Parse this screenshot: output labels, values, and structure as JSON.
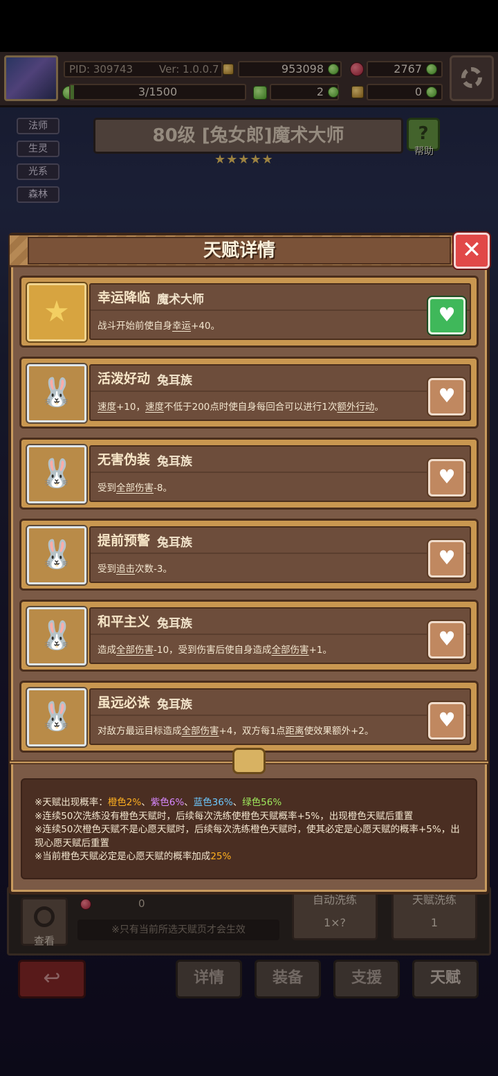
{
  "header": {
    "pid": "PID: 309743",
    "version": "Ver: 1.0.0.7",
    "gold": "953098",
    "gems": "2767",
    "progress": "3/1500",
    "progress_value": 0.002,
    "clover": "2",
    "key": "0"
  },
  "tags": [
    "法师",
    "生灵",
    "光系",
    "森林"
  ],
  "character": {
    "title": "80级  [兔女郎]魔术大师",
    "stars": "★★★★★",
    "help": "帮助"
  },
  "modal": {
    "title": "天赋详情",
    "close": "✕",
    "talents": [
      {
        "name": "幸运降临",
        "cls": "魔术大师",
        "desc_parts": [
          "战斗开始前使自身",
          "幸运",
          "+40。"
        ],
        "selected": true,
        "icon": "star-icon"
      },
      {
        "name": "活泼好动",
        "cls": "兔耳族",
        "desc_parts": [
          "速度",
          "+10，",
          "速度",
          "不低于200点时使自身每回合可以进行1次",
          "额外行动",
          "。"
        ],
        "selected": false,
        "icon": "bunny-icon"
      },
      {
        "name": "无害伪装",
        "cls": "兔耳族",
        "desc_parts": [
          "受到",
          "全部伤害",
          "-8。"
        ],
        "selected": false,
        "icon": "bunny-icon"
      },
      {
        "name": "提前预警",
        "cls": "兔耳族",
        "desc_parts": [
          "受到",
          "追击",
          "次数-3。"
        ],
        "selected": false,
        "icon": "bunny-icon"
      },
      {
        "name": "和平主义",
        "cls": "兔耳族",
        "desc_parts": [
          "造成",
          "全部伤害",
          "-10，受到伤害后使自身造成",
          "全部伤害",
          "+1。"
        ],
        "selected": false,
        "icon": "bunny-icon"
      },
      {
        "name": "虽远必诛",
        "cls": "兔耳族",
        "desc_parts": [
          "对敌方最远目标造成",
          "全部伤害",
          "+4，双方每1点",
          "距离",
          "使效果额外+2。"
        ],
        "selected": false,
        "icon": "bunny-icon"
      }
    ],
    "notes": {
      "line1_prefix": "※天赋出现概率：",
      "orange": "橙色2%",
      "purple": "紫色6%",
      "blue": "蓝色36%",
      "green": "绿色56%",
      "sep": "、",
      "line2": "※连续50次洗练没有橙色天赋时，后续每次洗练使橙色天赋概率+5%，出现橙色天赋后重置",
      "line3": "※连续50次橙色天赋不是心愿天赋时，后续每次洗练橙色天赋时，使其必定是心愿天赋的概率+5%，出现心愿天赋后重置",
      "line4_prefix": "※当前橙色天赋必定是心愿天赋的概率加成",
      "line4_value": "25%"
    }
  },
  "bottom": {
    "zero": "0",
    "hint": "※只有当前所选天赋页才会生效",
    "view": "查看",
    "wash1_label": "自动洗练",
    "wash1_value": "1×?",
    "wash2_label": "天赋洗练",
    "wash2_value": "1",
    "back": "↩",
    "nav": [
      "详情",
      "装备",
      "支援",
      "天赋"
    ]
  },
  "colors": {
    "accent_orange": "#ffb020",
    "accent_purple": "#d888ff",
    "accent_blue": "#6cc8ff",
    "accent_green": "#9ee85c",
    "selected_green": "#3fb85a",
    "close_red": "#e14848"
  }
}
